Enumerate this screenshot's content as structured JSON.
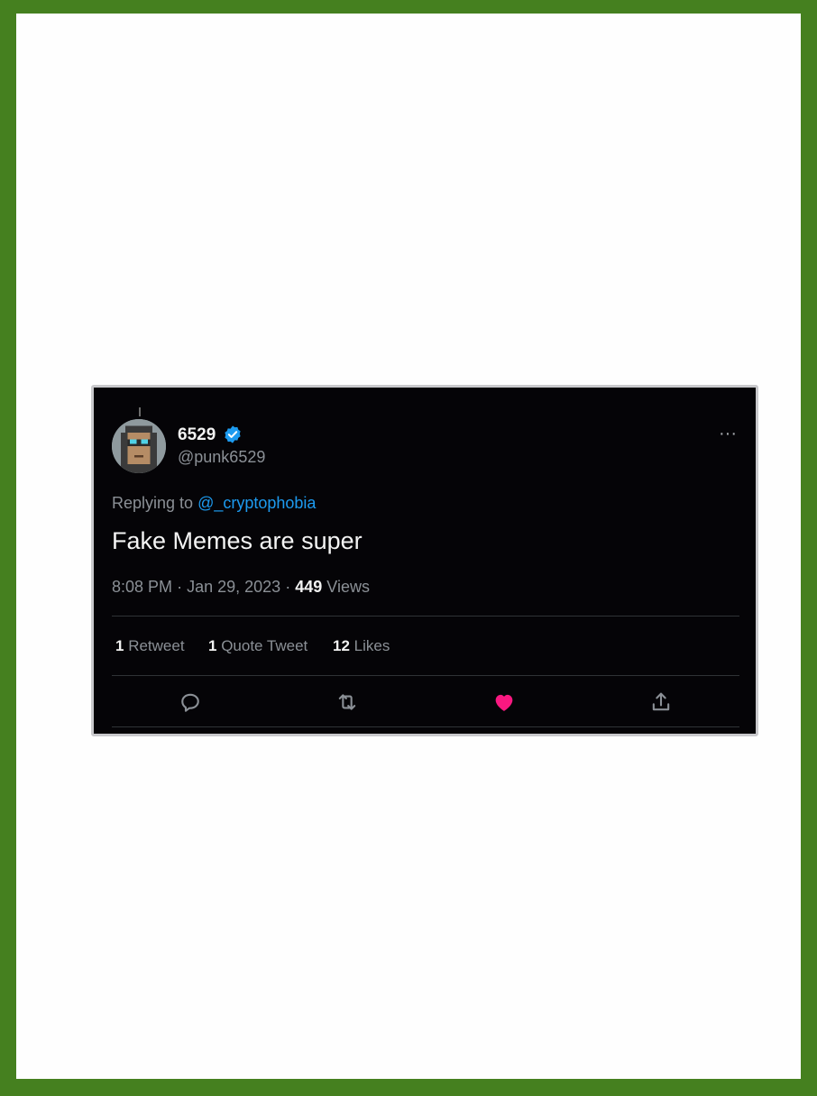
{
  "tweet": {
    "display_name": "6529",
    "handle": "@punk6529",
    "replying_prefix": "Replying to",
    "replying_to": "@_cryptophobia",
    "text": "Fake Memes are super",
    "time": "8:08 PM",
    "date": "Jan 29, 2023",
    "views_count": "449",
    "views_label": "Views",
    "more_label": "···"
  },
  "stats": {
    "retweets_count": "1",
    "retweets_label": "Retweet",
    "quotes_count": "1",
    "quotes_label": "Quote Tweet",
    "likes_count": "12",
    "likes_label": "Likes"
  },
  "colors": {
    "card_background": "#050407",
    "accent": "#1d9bf0",
    "like_active": "#f91880",
    "muted_text": "#8b9096",
    "outer_border": "#45801f"
  },
  "icons": {
    "verified": "verified-badge-icon",
    "more": "more-horizontal-icon",
    "reply": "reply-icon",
    "retweet": "retweet-icon",
    "like": "heart-filled-icon",
    "share": "share-icon"
  }
}
